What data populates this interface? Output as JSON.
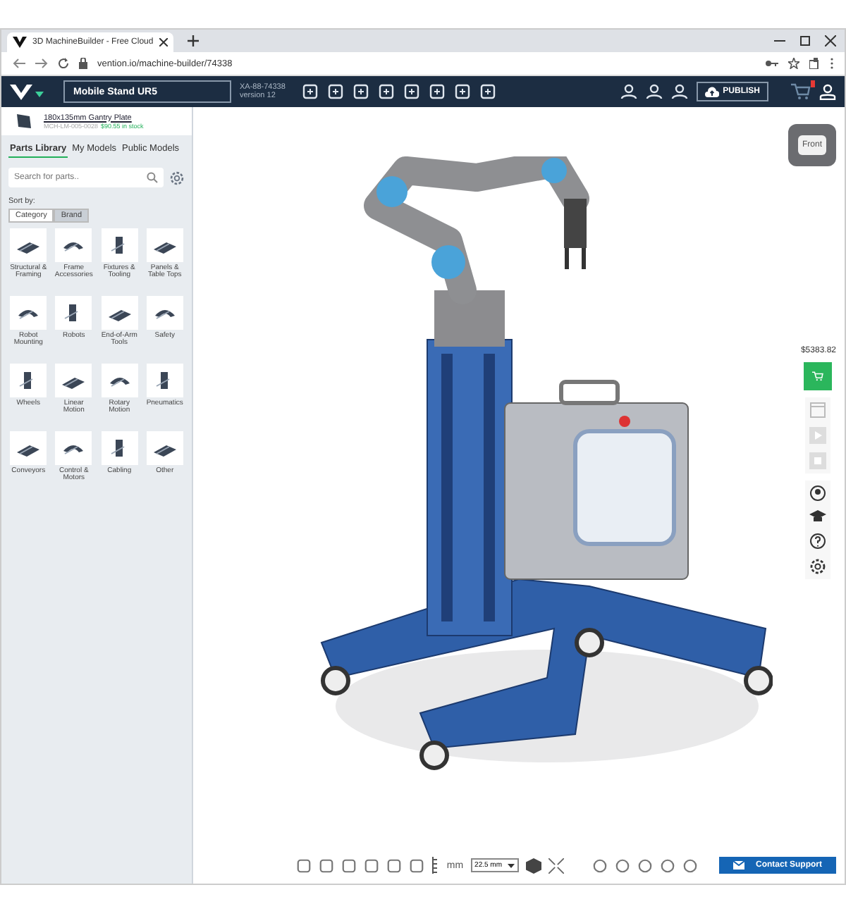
{
  "browser": {
    "tab_title": "3D MachineBuilder - Free Cloud",
    "url": "vention.io/machine-builder/74338"
  },
  "header": {
    "design_name": "Mobile Stand UR5",
    "design_id": "XA-88-74338",
    "version": "version 12",
    "publish_label": "PUBLISH"
  },
  "recent_part": {
    "name": "180x135mm Gantry Plate",
    "code": "MCH-LM-005-0028",
    "price": "$90.55 in stock"
  },
  "library_tabs": [
    {
      "label": "Parts Library",
      "selected": true
    },
    {
      "label": "My Models",
      "selected": false
    },
    {
      "label": "Public Models",
      "selected": false
    }
  ],
  "search": {
    "placeholder": "Search for parts.."
  },
  "sort": {
    "label": "Sort by:",
    "options": [
      {
        "label": "Category",
        "selected": true
      },
      {
        "label": "Brand",
        "selected": false
      }
    ]
  },
  "categories": [
    "Structural & Framing",
    "Frame Accessories",
    "Fixtures & Tooling",
    "Panels & Table Tops",
    "Robot Mounting",
    "Robots",
    "End-of-Arm Tools",
    "Safety",
    "Wheels",
    "Linear Motion",
    "Rotary Motion",
    "Pneumatics",
    "Conveyors",
    "Control & Motors",
    "Cabling",
    "Other"
  ],
  "view_cube": {
    "label": "Front"
  },
  "side_tools": {
    "price": "$5383.82"
  },
  "bottom_toolbar": {
    "unit": "mm",
    "step": "22.5 mm"
  },
  "support": {
    "label": "Contact Support"
  }
}
